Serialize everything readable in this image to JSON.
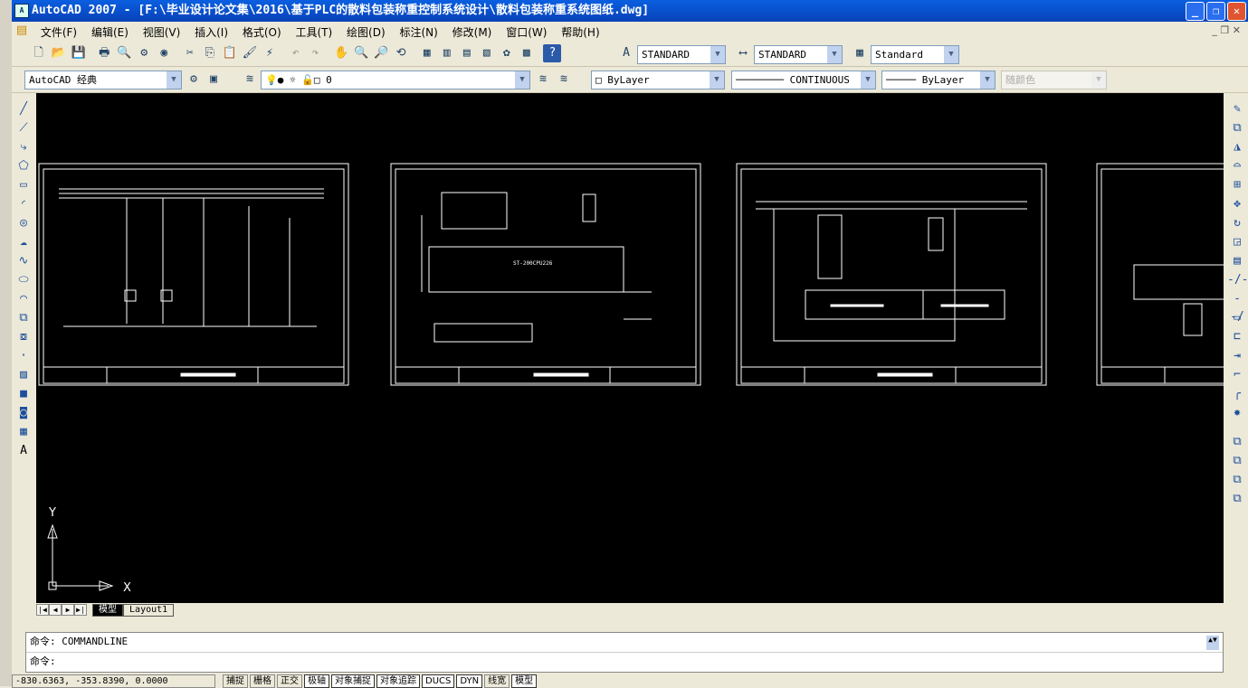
{
  "window": {
    "title": "AutoCAD 2007 - [F:\\毕业设计论文集\\2016\\基于PLC的散料包装称重控制系统设计\\散料包装称重系统图纸.dwg]",
    "app_icon": "A"
  },
  "menu": [
    "文件(F)",
    "编辑(E)",
    "视图(V)",
    "插入(I)",
    "格式(O)",
    "工具(T)",
    "绘图(D)",
    "标注(N)",
    "修改(M)",
    "窗口(W)",
    "帮助(H)"
  ],
  "styles": {
    "text_style": "STANDARD",
    "dim_style": "STANDARD",
    "table_style": "Standard"
  },
  "workspace": "AutoCAD 经典",
  "layer": "0",
  "properties": {
    "color": "ByLayer",
    "linetype": "CONTINUOUS",
    "lineweight": "ByLayer",
    "plotstyle": "随颜色"
  },
  "drawing": {
    "plc_label": "ST-200CPU226",
    "axis_x": "X",
    "axis_y": "Y"
  },
  "tabs": {
    "model": "模型",
    "layout1": "Layout1"
  },
  "command": {
    "history": "命令: COMMANDLINE",
    "prompt": "命令:"
  },
  "status": {
    "coords": "-830.6363, -353.8390, 0.0000",
    "buttons": [
      "捕捉",
      "栅格",
      "正交",
      "极轴",
      "对象捕捉",
      "对象追踪",
      "DUCS",
      "DYN",
      "线宽",
      "模型"
    ]
  }
}
